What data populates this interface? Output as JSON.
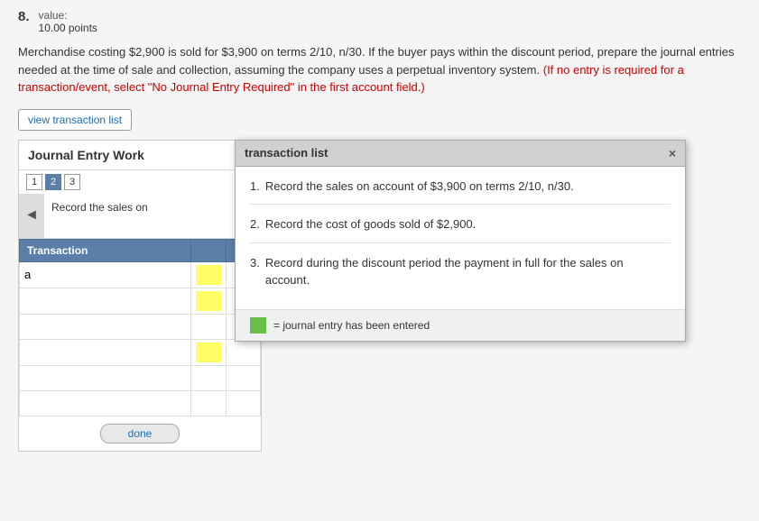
{
  "question": {
    "number": "8.",
    "value_label": "value:",
    "points": "10.00 points",
    "body_part1": "Merchandise costing $2,900 is sold for $3,900 on terms 2/10, n/30. If the buyer pays within the discount period, prepare the journal entries needed at the time of sale and collection, assuming the company uses a perpetual inventory system.",
    "body_part2_red": "(If no entry is required for a transaction/event, select \"No Journal Entry Required\" in the first account field.)"
  },
  "view_transaction_btn": "view transaction list",
  "journal": {
    "title": "Journal Entry Work",
    "nav_items": [
      "1",
      "2",
      "3"
    ],
    "active_nav": 2,
    "description": "Record the sales on",
    "nav_arrow": "◄",
    "table": {
      "headers": [
        "Transaction",
        "",
        ""
      ],
      "col1_header": "Transaction",
      "rows": [
        {
          "label": "a",
          "cell1": "",
          "cell2": ""
        },
        {
          "label": "",
          "cell1": "",
          "cell2": ""
        },
        {
          "label": "",
          "cell1": "",
          "cell2": ""
        },
        {
          "label": "",
          "cell1": "",
          "cell2": ""
        },
        {
          "label": "",
          "cell1": "",
          "cell2": ""
        },
        {
          "label": "",
          "cell1": "",
          "cell2": ""
        }
      ]
    },
    "done_btn": "done"
  },
  "modal": {
    "title": "transaction list",
    "close_btn": "×",
    "items": [
      {
        "num": "1.",
        "text": "Record the sales on account of $3,900 on terms 2/10, n/30."
      },
      {
        "num": "2.",
        "text": "Record the cost of goods sold of $2,900."
      },
      {
        "num": "3.",
        "text": "Record during the discount period the payment in full for the sales on account."
      }
    ],
    "legend_text": "= journal entry has been entered"
  }
}
